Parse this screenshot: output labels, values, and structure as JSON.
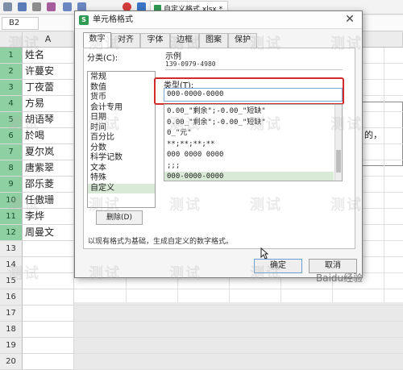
{
  "toolbar": {
    "doc_tab": "自定义格式.xlsx *",
    "icons": [
      "new-icon",
      "save-icon",
      "print-icon",
      "preview-icon",
      "undo-icon",
      "redo-icon",
      "wps-icon",
      "table-icon"
    ]
  },
  "formula_bar": {
    "namebox": "B2"
  },
  "sheet": {
    "columns": [
      "A"
    ],
    "rows": [
      {
        "num": "1",
        "value": "姓名",
        "selected": true
      },
      {
        "num": "2",
        "value": "许蔓安",
        "selected": true
      },
      {
        "num": "3",
        "value": "丁夜蕾",
        "selected": true
      },
      {
        "num": "4",
        "value": "方易",
        "selected": true
      },
      {
        "num": "5",
        "value": "胡语琴",
        "selected": true
      },
      {
        "num": "6",
        "value": "於喝",
        "selected": true
      },
      {
        "num": "7",
        "value": "夏尔岚",
        "selected": true
      },
      {
        "num": "8",
        "value": "唐紫翠",
        "selected": true
      },
      {
        "num": "9",
        "value": "邵乐菱",
        "selected": true
      },
      {
        "num": "10",
        "value": "任傲珊",
        "selected": true
      },
      {
        "num": "11",
        "value": "李烨",
        "selected": true
      },
      {
        "num": "12",
        "value": "周曼文",
        "selected": true
      },
      {
        "num": "13",
        "value": "",
        "selected": false
      },
      {
        "num": "14",
        "value": "",
        "selected": false
      },
      {
        "num": "15",
        "value": "",
        "selected": false
      },
      {
        "num": "16",
        "value": "",
        "selected": false
      },
      {
        "num": "17",
        "value": "",
        "selected": false
      },
      {
        "num": "18",
        "value": "",
        "selected": false
      },
      {
        "num": "19",
        "value": "",
        "selected": false
      },
      {
        "num": "20",
        "value": "",
        "selected": false
      }
    ],
    "side_text": "的，"
  },
  "dialog": {
    "title": "单元格格式",
    "tabs": [
      "数字",
      "对齐",
      "字体",
      "边框",
      "图案",
      "保护"
    ],
    "category_label": "分类(C):",
    "categories": [
      {
        "label": "常规",
        "selected": false
      },
      {
        "label": "数值",
        "selected": false
      },
      {
        "label": "货币",
        "selected": false
      },
      {
        "label": "会计专用",
        "selected": false
      },
      {
        "label": "日期",
        "selected": false
      },
      {
        "label": "时间",
        "selected": false
      },
      {
        "label": "百分比",
        "selected": false
      },
      {
        "label": "分数",
        "selected": false
      },
      {
        "label": "科学记数",
        "selected": false
      },
      {
        "label": "文本",
        "selected": false
      },
      {
        "label": "特殊",
        "selected": false
      },
      {
        "label": "自定义",
        "selected": true
      }
    ],
    "sample_label": "示例",
    "sample_value": "139-0979-4980",
    "type_label": "类型(T):",
    "type_value": "000-0000-0000",
    "formats": [
      {
        "label": "0.00_\"剩余\";-0.00_\"短缺\"",
        "selected": false
      },
      {
        "label": "0.00_\"剩余\";-0.00_\"短缺\"",
        "selected": false
      },
      {
        "label": "0_\"元\"",
        "selected": false
      },
      {
        "label": "**;**;**;**",
        "selected": false
      },
      {
        "label": "000 0000 0000",
        "selected": false
      },
      {
        "label": ";;;",
        "selected": false
      },
      {
        "label": "000-0000-0000",
        "selected": true
      }
    ],
    "delete_label": "删除(D)",
    "hint": "以现有格式为基础，生成自定义的数字格式。",
    "ok_label": "确定",
    "cancel_label": "取消"
  },
  "watermark": "测试",
  "footer_logo": "Baidu经验"
}
